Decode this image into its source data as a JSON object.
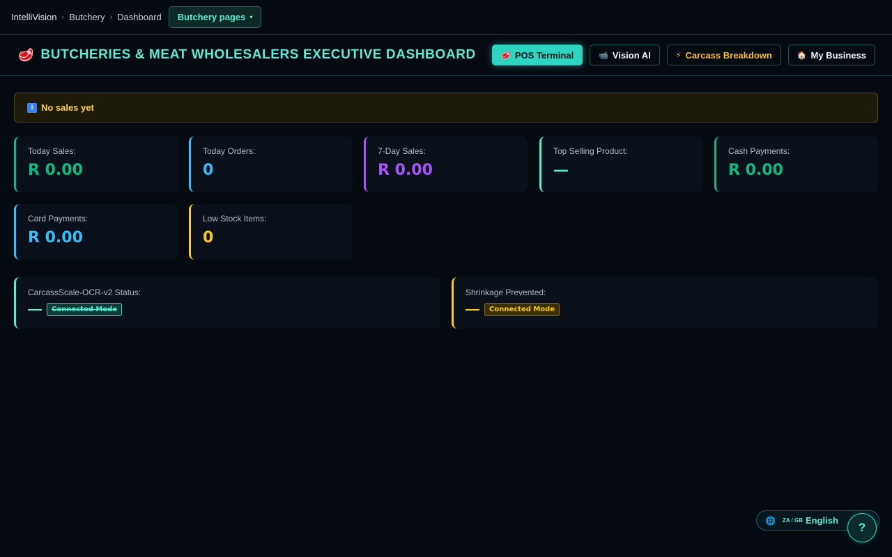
{
  "breadcrumb": {
    "items": [
      "IntelliVision",
      "Butchery",
      "Dashboard"
    ],
    "pages_button": "Butchery pages",
    "separator": "›",
    "caret": "▾"
  },
  "header": {
    "title_icon": "🥩",
    "title": "BUTCHERIES & MEAT WHOLESALERS EXECUTIVE DASHBOARD",
    "buttons": [
      {
        "icon": "🥩",
        "label": "POS Terminal"
      },
      {
        "icon": "📹",
        "label": "Vision AI"
      },
      {
        "icon": "⚡",
        "label": "Carcass Breakdown"
      },
      {
        "icon": "🏠",
        "label": "My Business"
      }
    ]
  },
  "alert": {
    "icon": "i",
    "text": "No sales yet"
  },
  "stats": [
    {
      "label": "Today Sales:",
      "value": "R 0.00"
    },
    {
      "label": "Today Orders:",
      "value": "0"
    },
    {
      "label": "7-Day Sales:",
      "value": "R 0.00"
    },
    {
      "label": "Top Selling Product:",
      "value": "—"
    },
    {
      "label": "Cash Payments:",
      "value": "R 0.00"
    },
    {
      "label": "Card Payments:",
      "value": "R 0.00"
    },
    {
      "label": "Low Stock Items:",
      "value": "0"
    }
  ],
  "status": [
    {
      "label": "CarcassScale-OCR-v2 Status:",
      "badge": "Connected Mode"
    },
    {
      "label": "Shrinkage Prevented:",
      "badge": "Connected Mode"
    }
  ],
  "language": {
    "icon": "🌐",
    "flags": "ZA / GB",
    "label": "English"
  },
  "help": {
    "label": "?"
  },
  "colors": {
    "accent": "#5eead4",
    "green": "#10b981",
    "blue": "#38bdf8",
    "purple": "#a855f7",
    "yellow": "#facc15",
    "background": "#060b12"
  }
}
